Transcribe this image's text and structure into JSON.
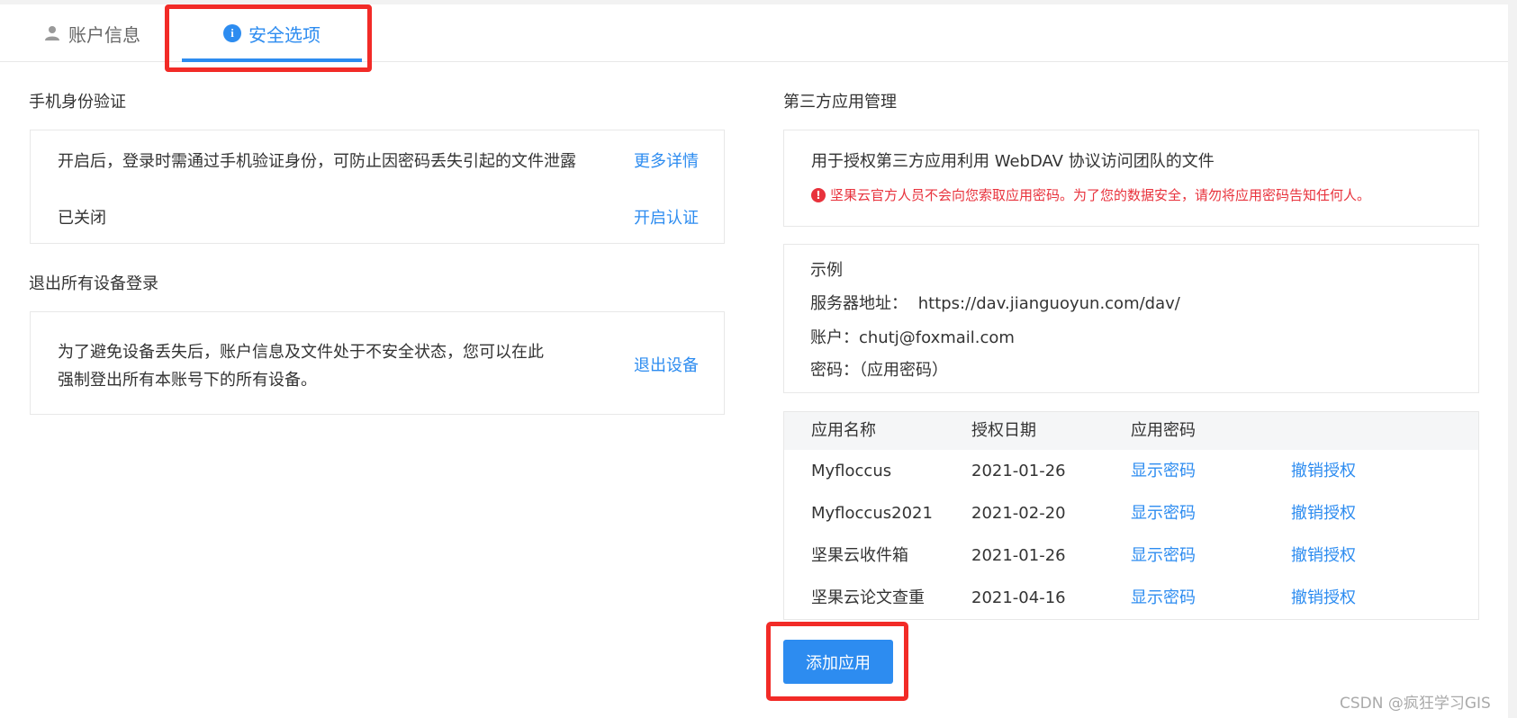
{
  "tabs": [
    {
      "label": "账户信息",
      "icon": "person-icon"
    },
    {
      "label": "安全选项",
      "icon": "info-icon",
      "active": true
    }
  ],
  "phone_verification": {
    "title": "手机身份验证",
    "description": "开启后，登录时需通过手机验证身份，可防止因密码丢失引起的文件泄露",
    "details_link": "更多详情",
    "status": "已关闭",
    "enable_link": "开启认证"
  },
  "logout_devices": {
    "title": "退出所有设备登录",
    "description_line1": "为了避免设备丢失后，账户信息及文件处于不安全状态，您可以在此",
    "description_line2": "强制登出所有本账号下的所有设备。",
    "logout_link": "退出设备"
  },
  "third_party": {
    "title": "第三方应用管理",
    "description": "用于授权第三方应用利用 WebDAV 协议访问团队的文件",
    "warning": "坚果云官方人员不会向您索取应用密码。为了您的数据安全，请勿将应用密码告知任何人。",
    "example": {
      "heading": "示例",
      "server_label": "服务器地址：",
      "server_value": "https://dav.jianguoyun.com/dav/",
      "account_label": "账户：",
      "account_value": "chutj@foxmail.com",
      "password_label": "密码：",
      "password_value": "（应用密码）"
    },
    "table": {
      "headers": [
        "应用名称",
        "授权日期",
        "应用密码"
      ],
      "rows": [
        {
          "name": "Myfloccus",
          "date": "2021-01-26",
          "show": "显示密码",
          "revoke": "撤销授权"
        },
        {
          "name": "Myfloccus2021",
          "date": "2021-02-20",
          "show": "显示密码",
          "revoke": "撤销授权"
        },
        {
          "name": "坚果云收件箱",
          "date": "2021-01-26",
          "show": "显示密码",
          "revoke": "撤销授权"
        },
        {
          "name": "坚果云论文查重",
          "date": "2021-04-16",
          "show": "显示密码",
          "revoke": "撤销授权"
        }
      ]
    },
    "add_button": "添加应用"
  },
  "watermark": "CSDN @疯狂学习GIS",
  "colors": {
    "accent": "#2d8cf0",
    "warning": "#e8323c",
    "highlight": "#f22b27"
  }
}
